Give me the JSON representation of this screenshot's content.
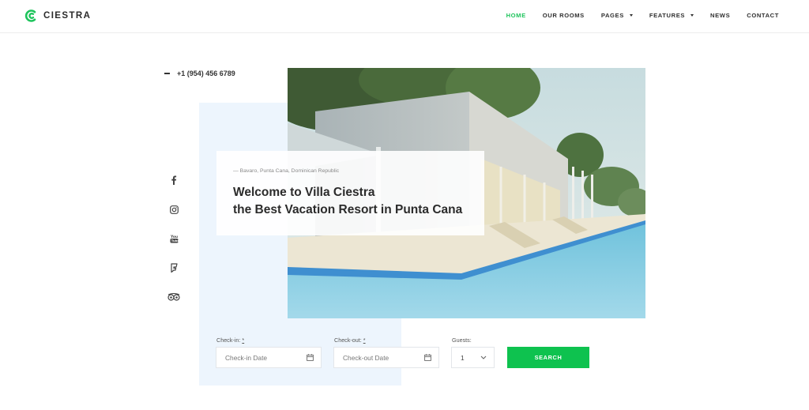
{
  "brand": {
    "name": "CIESTRA",
    "accent_color": "#1ec45c",
    "button_color": "#0ec24f",
    "panel_color": "#edf5fd"
  },
  "nav": {
    "items": [
      {
        "label": "HOME",
        "active": true,
        "dropdown": false
      },
      {
        "label": "OUR ROOMS",
        "active": false,
        "dropdown": false
      },
      {
        "label": "PAGES",
        "active": false,
        "dropdown": true
      },
      {
        "label": "FEATURES",
        "active": false,
        "dropdown": true
      },
      {
        "label": "NEWS",
        "active": false,
        "dropdown": false
      },
      {
        "label": "CONTACT",
        "active": false,
        "dropdown": false
      }
    ]
  },
  "contact": {
    "phone": "+1 (954) 456 6789"
  },
  "social": [
    "facebook-icon",
    "instagram-icon",
    "youtube-icon",
    "foursquare-icon",
    "tripadvisor-icon"
  ],
  "hero": {
    "location": "— Bavaro, Punta Cana, Dominican Republic",
    "title_line1": "Welcome to Villa Ciestra",
    "title_line2": "the Best Vacation Resort in Punta Cana",
    "image": "villa-pool-photo"
  },
  "booking": {
    "checkin": {
      "label": "Check-in:",
      "required": "*",
      "placeholder": "Check-in Date"
    },
    "checkout": {
      "label": "Check-out:",
      "required": "*",
      "placeholder": "Check-out Date"
    },
    "guests": {
      "label": "Guests:",
      "value": "1"
    },
    "search_label": "SEARCH"
  }
}
